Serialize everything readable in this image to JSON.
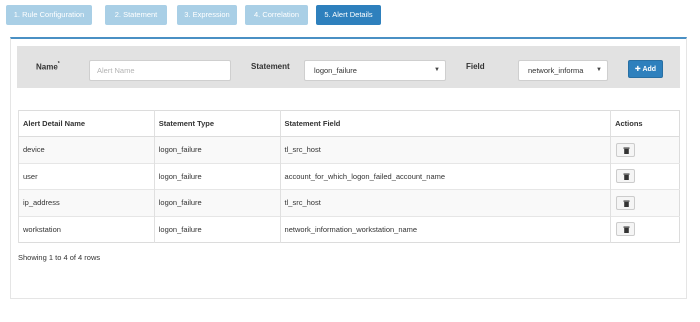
{
  "steps": [
    {
      "label": "1. Rule Configuration",
      "active": false
    },
    {
      "label": "2. Statement",
      "active": false
    },
    {
      "label": "3. Expression",
      "active": false
    },
    {
      "label": "4. Correlation",
      "active": false
    },
    {
      "label": "5. Alert Details",
      "active": true
    }
  ],
  "form": {
    "name_label": "Name",
    "required_mark": "*",
    "name_placeholder": "Alert Name",
    "statement_label": "Statement",
    "statement_value": "logon_failure",
    "field_label": "Field",
    "field_value": "network_informa",
    "add_label": "Add"
  },
  "table": {
    "headers": [
      "Alert Detail Name",
      "Statement Type",
      "Statement Field",
      "Actions"
    ],
    "rows": [
      {
        "name": "device",
        "type": "logon_failure",
        "field": "tl_src_host"
      },
      {
        "name": "user",
        "type": "logon_failure",
        "field": "account_for_which_logon_failed_account_name"
      },
      {
        "name": "ip_address",
        "type": "logon_failure",
        "field": "tl_src_host"
      },
      {
        "name": "workstation",
        "type": "logon_failure",
        "field": "network_information_workstation_name"
      }
    ]
  },
  "footer": {
    "text": "Showing 1 to 4 of 4 rows"
  },
  "colors": {
    "active_step": "#2e80bd",
    "inactive_step": "#a9cfe6",
    "panel_border": "#4a90c4"
  }
}
